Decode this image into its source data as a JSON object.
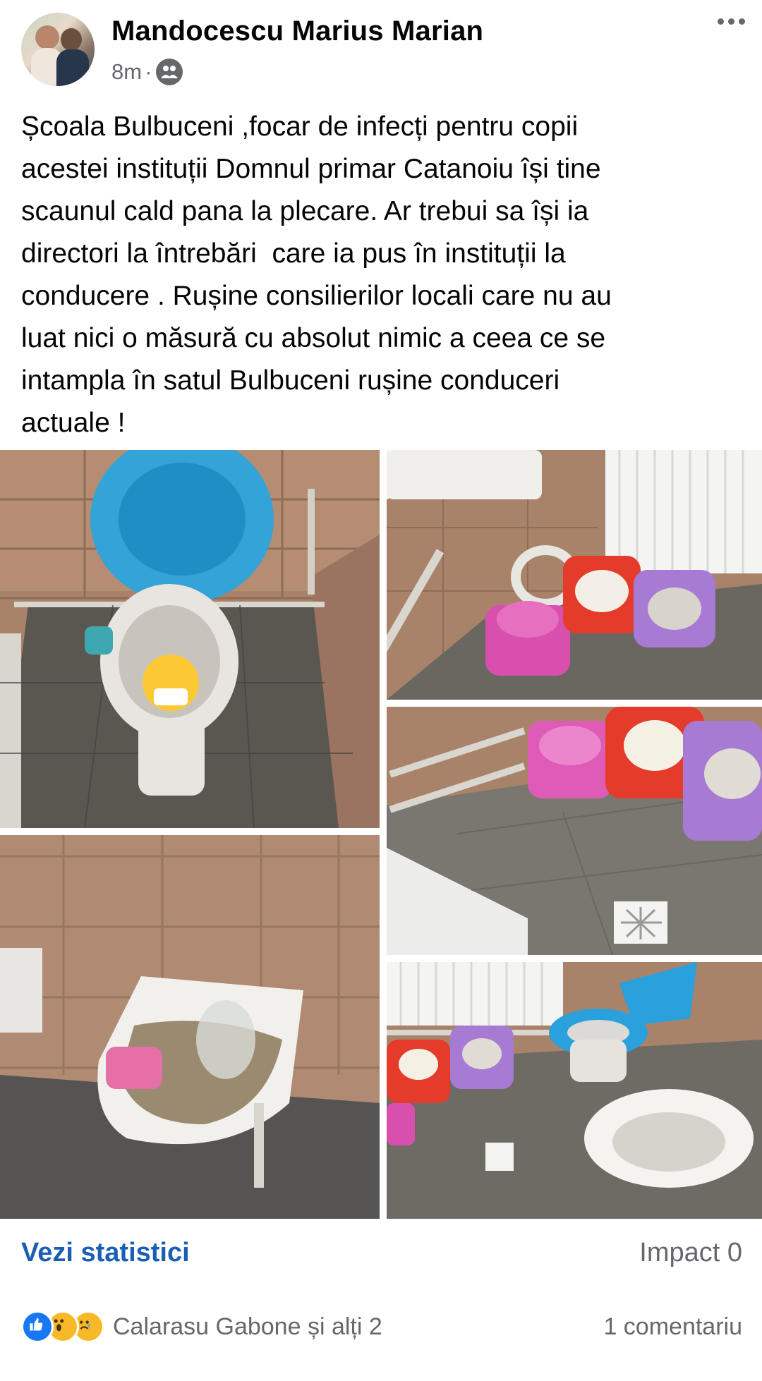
{
  "post": {
    "author": "Mandocescu Marius Marian",
    "time": "8m",
    "separator": "·",
    "audience_icon": "friends-icon",
    "more_icon": "more-options-icon",
    "text": "Școala Bulbuceni ,focar de infecți pentru copii\nacestei instituții Domnul primar Catanoiu își tine\nscaunul cald pana la plecare. Ar trebui sa își ia\ndirectori la întrebări  care ia pus în instituții la\nconducere . Rușine consilierilor locali care nu au\nluat nici o măsură cu absolut nimic a ceea ce se\nintampla în satul Bulbuceni rușine conduceri\nactuale !"
  },
  "footer": {
    "stats_label": "Vezi statistici",
    "impact_label": "Impact 0",
    "reactions_text": "Calarasu Gabone și alți 2",
    "reaction_icons": [
      "like-icon",
      "wow-icon",
      "sad-icon"
    ],
    "comments_label": "1 comentariu"
  },
  "colors": {
    "link": "#1b5fb5",
    "secondary_text": "#65676b",
    "like": "#1877f2",
    "emoji": "#f7b928"
  }
}
